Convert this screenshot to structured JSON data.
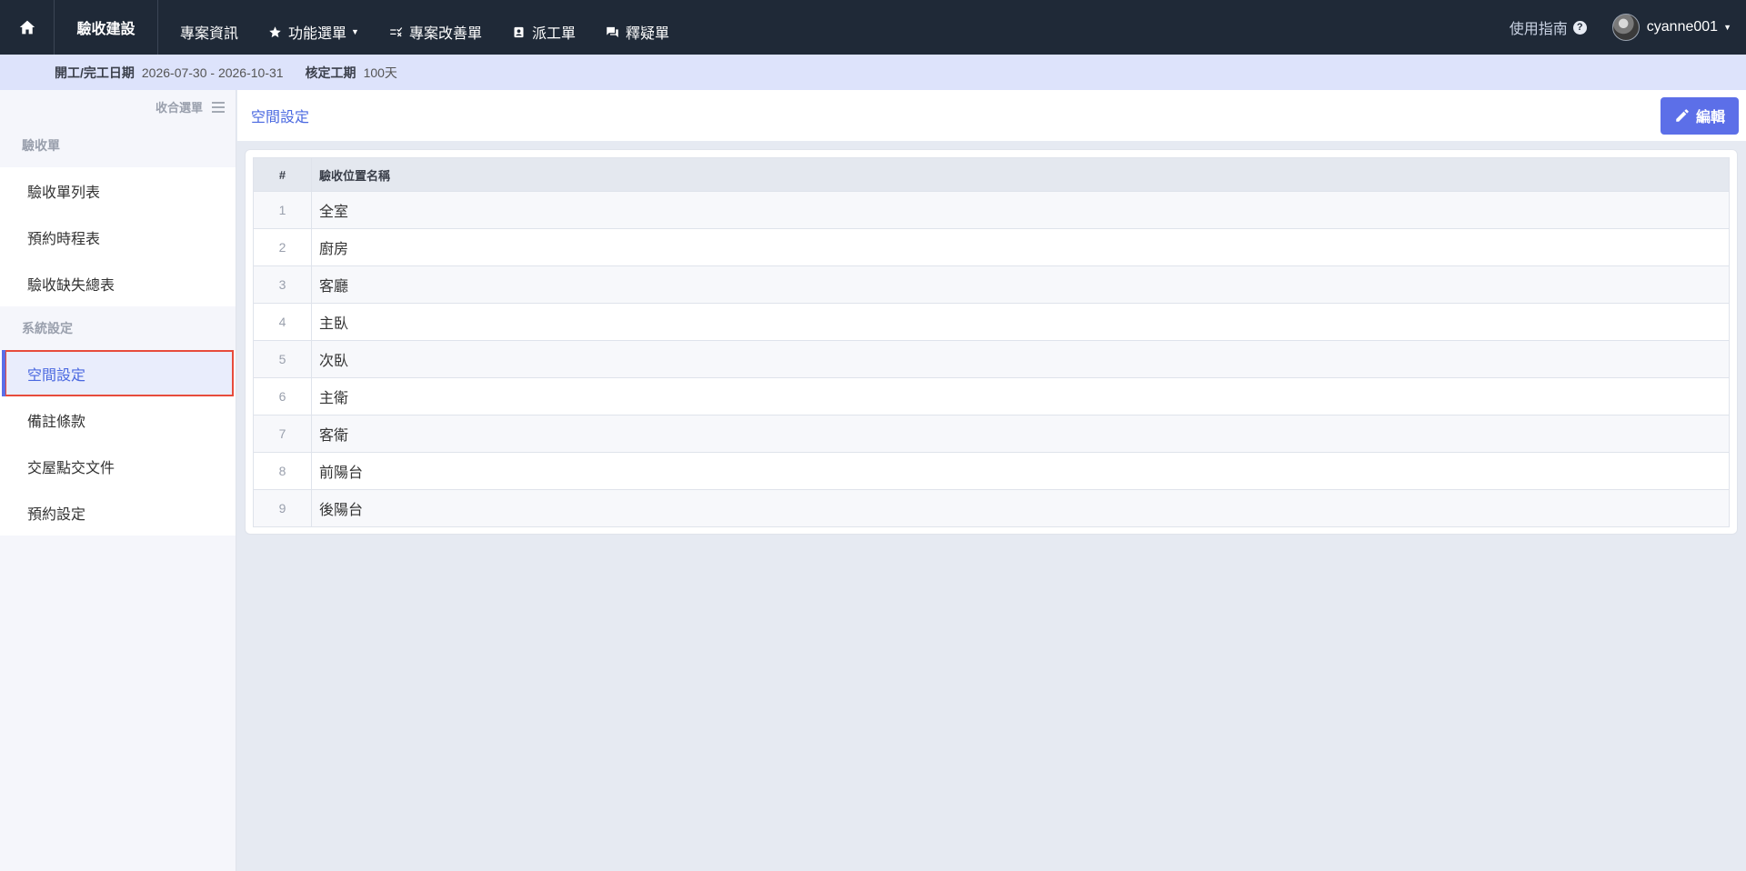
{
  "nav": {
    "brand": "驗收建設",
    "items": [
      {
        "label": "專案資訊",
        "icon": ""
      },
      {
        "label": "功能選單",
        "icon": "star-icon",
        "caret": true
      },
      {
        "label": "專案改善單",
        "icon": "checklist-icon"
      },
      {
        "label": "派工單",
        "icon": "badge-icon"
      },
      {
        "label": "釋疑單",
        "icon": "chat-icon"
      }
    ],
    "guide": "使用指南",
    "username": "cyanne001"
  },
  "infobar": {
    "period_label": "開工/完工日期",
    "period_value": "2026-07-30 - 2026-10-31",
    "duration_label": "核定工期",
    "duration_value": "100天"
  },
  "sidebar": {
    "collapse_label": "收合選單",
    "sections": [
      {
        "title": "驗收單",
        "items": [
          "驗收單列表",
          "預約時程表",
          "驗收缺失總表"
        ]
      },
      {
        "title": "系統設定",
        "items": [
          "空間設定",
          "備註條款",
          "交屋點交文件",
          "預約設定"
        ]
      }
    ],
    "active": "空間設定"
  },
  "main": {
    "title": "空間設定",
    "edit_label": "編輯",
    "table": {
      "headers": [
        "#",
        "驗收位置名稱"
      ],
      "rows": [
        [
          "1",
          "全室"
        ],
        [
          "2",
          "廚房"
        ],
        [
          "3",
          "客廳"
        ],
        [
          "4",
          "主臥"
        ],
        [
          "5",
          "次臥"
        ],
        [
          "6",
          "主衛"
        ],
        [
          "7",
          "客衛"
        ],
        [
          "8",
          "前陽台"
        ],
        [
          "9",
          "後陽台"
        ]
      ]
    }
  },
  "colors": {
    "nav_bg": "#1f2937",
    "accent": "#5c6fe8",
    "infobar_bg": "#dde3fb",
    "active_outline": "#e74c3c"
  }
}
